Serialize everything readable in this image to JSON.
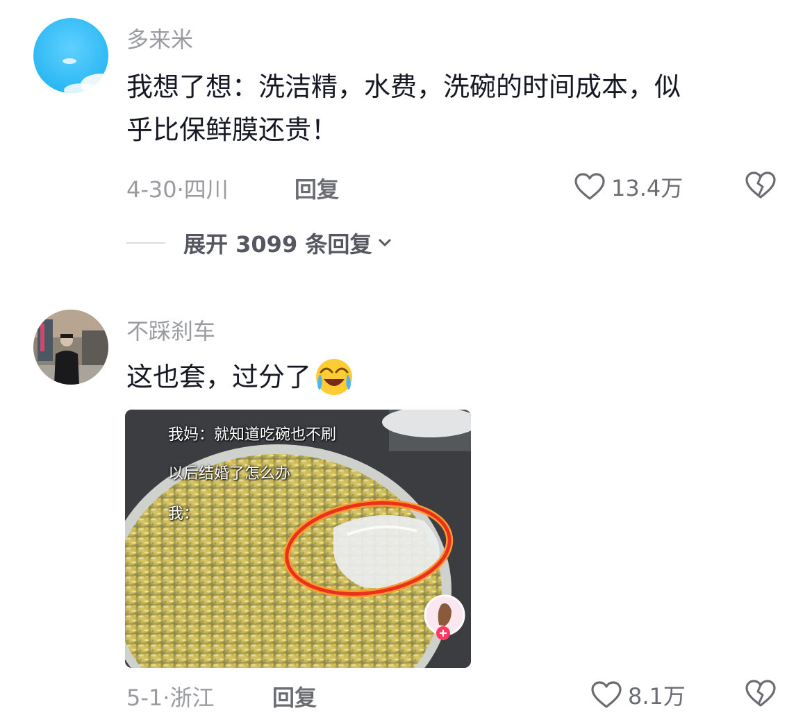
{
  "comments": [
    {
      "username": "多来米",
      "text_line1": "我想了想：洗洁精，水费，洗碗的时间成本，似",
      "text_line2": "乎比保鲜膜还贵！",
      "date": "4-30",
      "separator": "·",
      "location": "四川",
      "reply_label": "回复",
      "likes": "13.4万",
      "expand_label": "展开 3099 条回复"
    },
    {
      "username": "不踩刹车",
      "text": "这也套，过分了",
      "emoji": "crying-laughing-emoji",
      "image_caption": {
        "line1": "我妈：就知道吃碗也不刷",
        "line2": "以后结婚了怎么办",
        "line3": "我："
      },
      "date": "5-1",
      "separator": "·",
      "location": "浙江",
      "reply_label": "回复",
      "likes": "8.1万"
    }
  ],
  "colors": {
    "meta_gray": "#9a9ba1",
    "body_text": "#161823",
    "action_gray": "#6b6c72",
    "highlight_red": "#e8321e",
    "highlight_orange": "#ff9a2e"
  }
}
